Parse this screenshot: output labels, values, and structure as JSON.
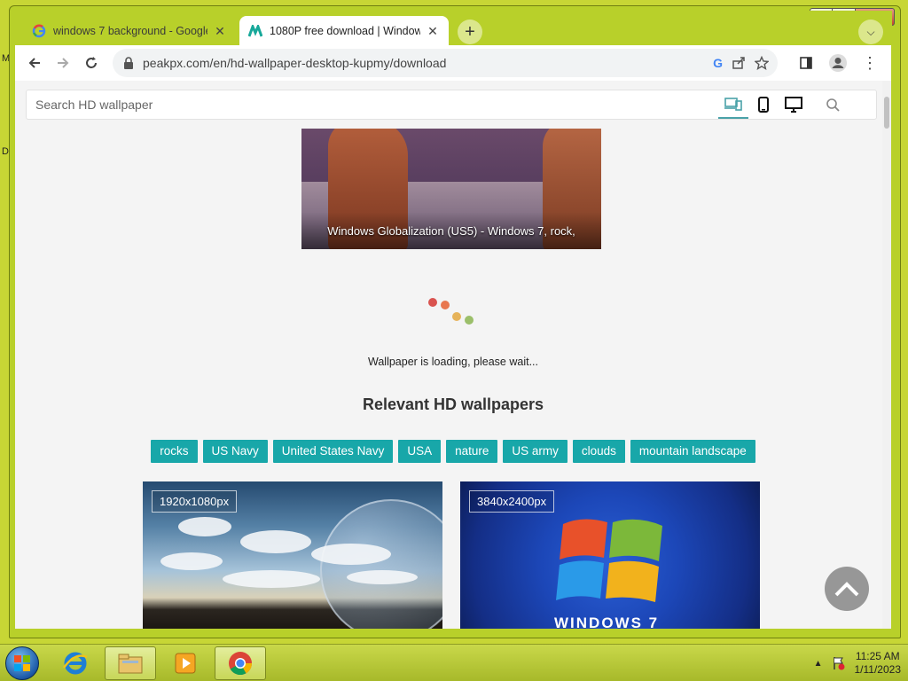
{
  "desktop": {
    "letters": [
      "M",
      "D"
    ]
  },
  "browser": {
    "tabs": [
      {
        "title": "windows 7 background - Google",
        "active": false
      },
      {
        "title": "1080P free download | Windows",
        "active": true
      }
    ],
    "new_tab": "+",
    "url": "peakpx.com/en/hd-wallpaper-desktop-kupmy/download"
  },
  "page": {
    "search_placeholder": "Search HD wallpaper",
    "hero_caption": "Windows Globalization (US5) - Windows 7, rock,",
    "loading_text": "Wallpaper is loading, please wait...",
    "relevant_heading": "Relevant HD wallpapers",
    "tags": [
      "rocks",
      "US Navy",
      "United States Navy",
      "USA",
      "nature",
      "US army",
      "clouds",
      "mountain landscape"
    ],
    "thumbs": [
      {
        "resolution": "1920x1080px"
      },
      {
        "resolution": "3840x2400px",
        "logo_text": "WINDOWS 7"
      }
    ],
    "loader_colors": [
      "#d9534f",
      "#e8774f",
      "#e6b35a",
      "#9bbf6a"
    ]
  },
  "taskbar": {
    "time": "11:25 AM",
    "date": "1/11/2023"
  },
  "colors": {
    "tag_bg": "#18a7a9",
    "window_frame": "#b8d02a"
  }
}
